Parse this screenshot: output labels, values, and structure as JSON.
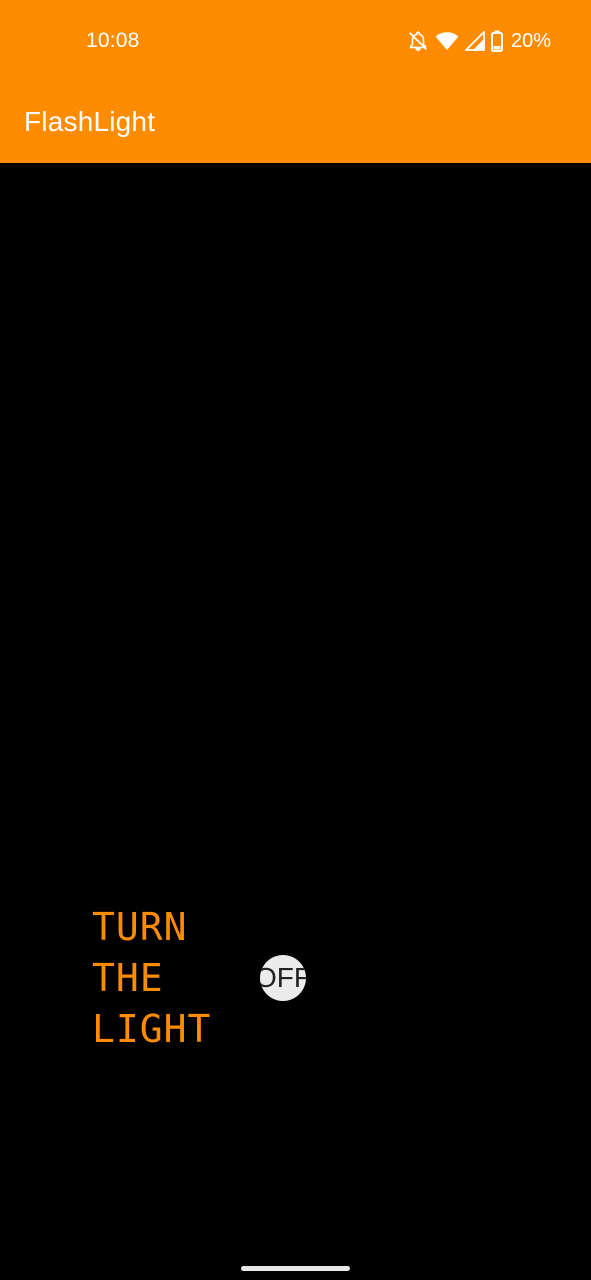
{
  "status_bar": {
    "time": "10:08",
    "battery": "20%",
    "icons": [
      "notifications-off-icon",
      "wifi-icon",
      "cellular-signal-icon",
      "battery-icon"
    ]
  },
  "app_bar": {
    "title": "FlashLight",
    "background_color": "#FF8C00"
  },
  "flashlight_control": {
    "label_lines": [
      "TURN",
      "THE",
      "LIGHT"
    ],
    "toggle_text": "OFF",
    "label_color": "#FF8C00"
  },
  "background_color": "#000000"
}
